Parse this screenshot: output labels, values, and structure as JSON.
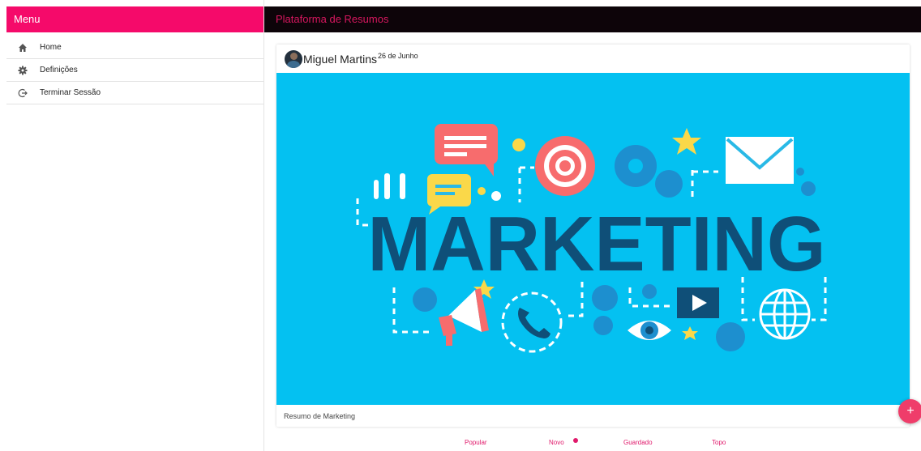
{
  "sidebar": {
    "title": "Menu",
    "items": [
      {
        "label": "Home",
        "icon": "home-icon"
      },
      {
        "label": "Definições",
        "icon": "gear-icon"
      },
      {
        "label": "Terminar Sessão",
        "icon": "logout-icon"
      }
    ]
  },
  "topbar": {
    "title": "Plataforma de Resumos"
  },
  "post": {
    "author": "Miguel Martins",
    "date": "26 de Junho",
    "image_text": "MARKETING",
    "caption": "Resumo de Marketing"
  },
  "bottom_nav": {
    "items": [
      {
        "label": "Popular"
      },
      {
        "label": "Novo"
      },
      {
        "label": "Guardado"
      },
      {
        "label": "Topo"
      }
    ]
  },
  "fab": {
    "label": "+"
  },
  "colors": {
    "accent": "#f50a6a",
    "topbar_bg": "#0d0409",
    "image_bg": "#04c1f1",
    "image_text": "#0f4f78"
  }
}
